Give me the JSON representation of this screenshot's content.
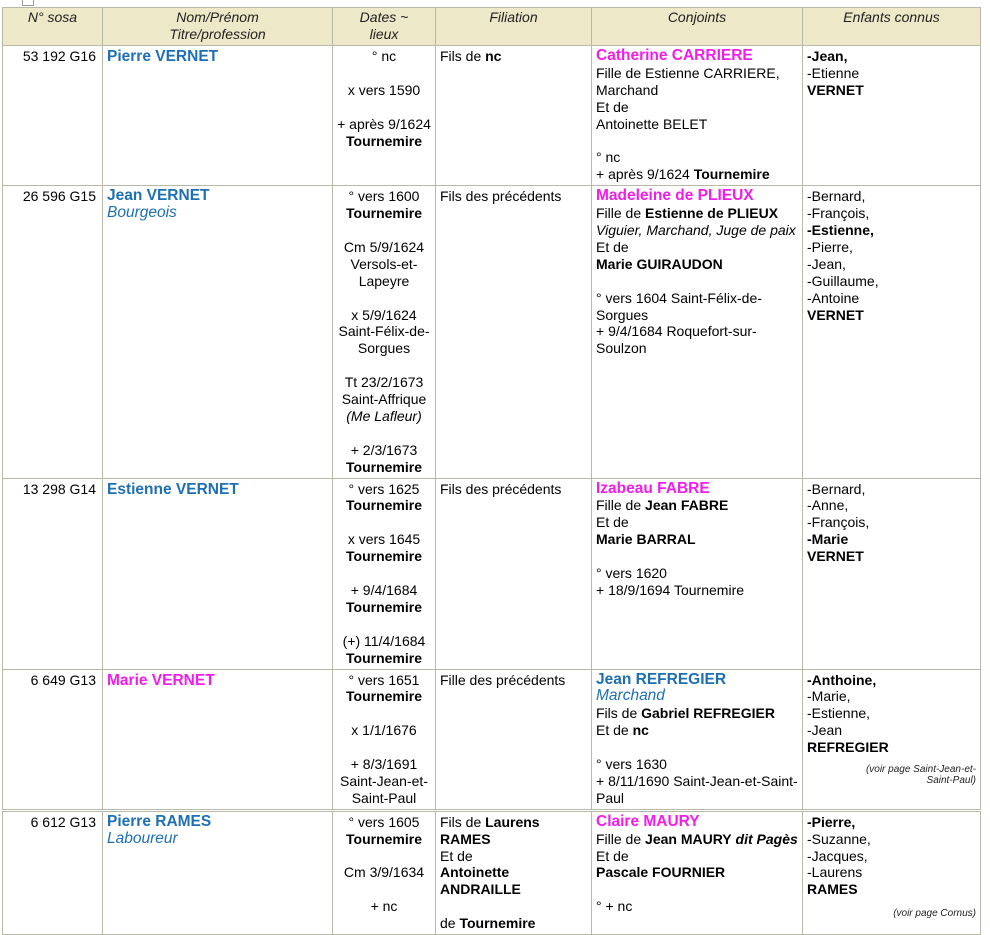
{
  "headers": [
    "N° sosa",
    "Nom/Prénom",
    "Titre/profession",
    "Dates ~",
    "lieux",
    "Filiation",
    "Conjoints",
    "Enfants connus"
  ],
  "rows": [
    {
      "sosa": "53 192 G16",
      "name": "Pierre VERNET",
      "dates": [
        "° nc",
        "",
        "x vers 1590",
        "",
        "+ après 9/1624"
      ],
      "dates_place": "Tournemire",
      "filiation_pre": "Fils de ",
      "filiation_bold": "nc",
      "spouse_name": "Catherine CARRIERE",
      "spouse_lines": [
        "Fille de Estienne CARRIERE,",
        "Marchand",
        "Et de",
        "Antoinette BELET",
        "",
        "° nc"
      ],
      "spouse_death_pre": "+ après 9/1624 ",
      "spouse_death_place": "Tournemire",
      "children_first": "-Jean,",
      "children": [
        "-Etienne"
      ],
      "children_surname": "VERNET"
    },
    {
      "sosa": "26 596 G15",
      "name": "Jean VERNET",
      "title": "Bourgeois",
      "filiation": "Fils des précédents",
      "spouse_name": "Madeleine de PLIEUX",
      "spouse_father_pre": "Fille de ",
      "spouse_father": "Estienne de PLIEUX",
      "spouse_father_title": "Viguier, Marchand, Juge de paix",
      "spouse_and": "Et de",
      "spouse_mother": "Marie GUIRAUDON",
      "spouse_birth": "° vers 1604 Saint-Félix-de-Sorgues",
      "spouse_death": "+ 9/4/1684 Roquefort-sur-Soulzon",
      "children_list": [
        "-Bernard,",
        "-François,"
      ],
      "children_bold": "-Estienne,",
      "children": [
        "-Pierre,",
        "-Jean,",
        "-Guillaume,",
        "-Antoine"
      ],
      "children_surname": "VERNET",
      "d_birth": "° vers 1600",
      "d_birth_place": "Tournemire",
      "d_cm": "Cm 5/9/1624",
      "d_cm_place": "Versols-et-Lapeyre",
      "d_marr": "x 5/9/1624",
      "d_marr_place": "Saint-Félix-de-Sorgues",
      "d_tt": "Tt 23/2/1673",
      "d_tt_place": "Saint-Affrique",
      "d_tt_notary": "(Me Lafleur)",
      "d_death": "+ 2/3/1673",
      "d_death_place": "Tournemire"
    },
    {
      "sosa": "13 298 G14",
      "name": "Estienne VERNET",
      "filiation": "Fils des précédents",
      "spouse_name": "Izabeau FABRE",
      "spouse_father_pre": "Fille de ",
      "spouse_father": "Jean FABRE",
      "spouse_and": "Et de",
      "spouse_mother": "Marie BARRAL",
      "spouse_birth": "° vers 1620",
      "spouse_death": "+ 18/9/1694 Tournemire",
      "children": [
        "-Bernard,",
        "-Anne,",
        "-François,"
      ],
      "children_bold": "-Marie",
      "children_surname": "VERNET",
      "d_birth": "° vers 1625",
      "d_birth_place": "Tournemire",
      "d_marr": "x vers 1645",
      "d_marr_place": "Tournemire",
      "d_death": "+ 9/4/1684",
      "d_death_place": "Tournemire",
      "d_burial": "(+) 11/4/1684",
      "d_burial_place": "Tournemire"
    },
    {
      "sosa": "6 649 G13",
      "name": "Marie VERNET",
      "filiation": "Fille des précédents",
      "spouse_name": "Jean REFREGIER",
      "spouse_title": "Marchand",
      "spouse_father_pre": "Fils de ",
      "spouse_father": "Gabriel REFREGIER",
      "spouse_and_pre": "Et de ",
      "spouse_mother": "nc",
      "spouse_birth": "° vers 1630",
      "spouse_death": "+ 8/11/1690 Saint-Jean-et-Saint-Paul",
      "children_bold": "-Anthoine,",
      "children": [
        "-Marie,",
        "-Estienne,",
        "-Jean"
      ],
      "children_surname": "REFREGIER",
      "note": "(voir page Saint-Jean-et-Saint-Paul)",
      "d_birth": "° vers 1651",
      "d_birth_place": "Tournemire",
      "d_marr": "x 1/1/1676",
      "d_death": "+ 8/3/1691",
      "d_death_place": "Saint-Jean-et-Saint-Paul"
    },
    {
      "sosa": "6 612 G13",
      "name": "Pierre RAMES",
      "title": "Laboureur",
      "filiation_pre": "Fils de ",
      "filiation_father": "Laurens RAMES",
      "filiation_and": "Et de",
      "filiation_mother": "Antoinette ANDRAILLE",
      "filiation_from_pre": "de ",
      "filiation_from": "Tournemire",
      "spouse_name": "Claire MAURY",
      "spouse_father_pre": "Fille de ",
      "spouse_father": "Jean MAURY",
      "spouse_father_dit": "dit Pagès",
      "spouse_and": "Et de",
      "spouse_mother": "Pascale FOURNIER",
      "spouse_death": "° + nc",
      "children_bold": "-Pierre,",
      "children": [
        "-Suzanne,",
        "-Jacques,",
        "-Laurens"
      ],
      "children_surname": "RAMES",
      "note": "(voir page Cornus)",
      "d_birth": "° vers 1605",
      "d_birth_place": "Tournemire",
      "d_cm": "Cm 3/9/1634",
      "d_death": "+ nc"
    }
  ]
}
